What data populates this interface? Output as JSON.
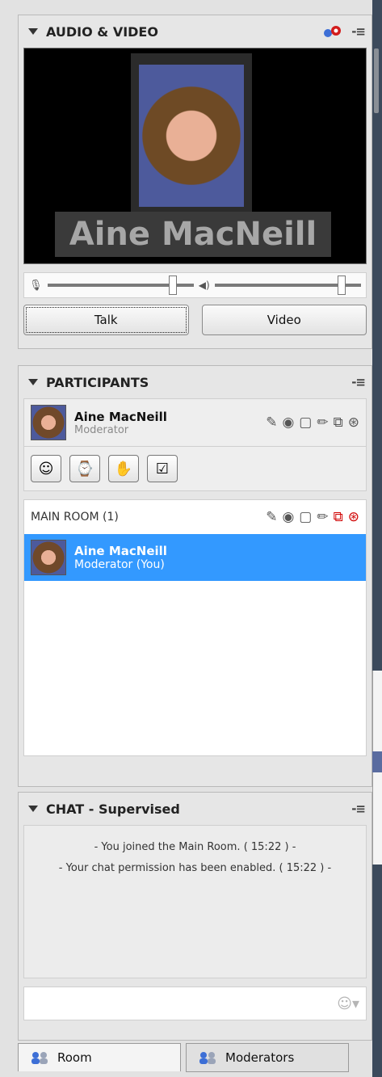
{
  "audio_video": {
    "title": "AUDIO & VIDEO",
    "speaker_name": "Aine MacNeill",
    "talk_label": "Talk",
    "video_label": "Video"
  },
  "participants": {
    "title": "PARTICIPANTS",
    "me": {
      "name": "Aine MacNeill",
      "role": "Moderator"
    },
    "room_label": "MAIN ROOM (1)",
    "list": [
      {
        "name": "Aine MacNeill",
        "role": "Moderator (You)"
      }
    ]
  },
  "chat": {
    "title": "CHAT - Supervised",
    "messages": [
      "- You joined the Main Room. ( 15:22 ) -",
      "- Your chat permission has been enabled. ( 15:22 ) -"
    ]
  },
  "tabs": [
    {
      "label": "Room"
    },
    {
      "label": "Moderators"
    }
  ],
  "colors": {
    "selection": "#3399ff",
    "panel_bg": "#e6e6e6"
  }
}
